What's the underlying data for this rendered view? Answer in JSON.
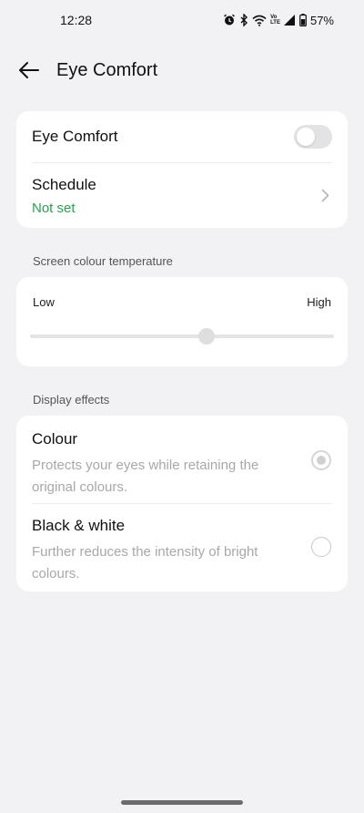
{
  "status_bar": {
    "time": "12:28",
    "battery": "57%",
    "icons": [
      "alarm-icon",
      "bluetooth-icon",
      "wifi-icon",
      "volte-icon",
      "signal-icon",
      "battery-icon"
    ],
    "volte_label_top": "Vo",
    "volte_label_bottom": "LTE"
  },
  "header": {
    "title": "Eye Comfort",
    "back_icon": "arrow-left-icon"
  },
  "eye_comfort": {
    "label": "Eye Comfort",
    "enabled": false
  },
  "schedule": {
    "label": "Schedule",
    "value": "Not set"
  },
  "temperature": {
    "section_label": "Screen colour temperature",
    "low_label": "Low",
    "high_label": "High",
    "level": 0.58
  },
  "display_effects": {
    "section_label": "Display effects",
    "options": [
      {
        "title": "Colour",
        "description": "Protects your eyes while retaining the original colours.",
        "selected": true
      },
      {
        "title": "Black & white",
        "description": "Further reduces the intensity of bright colours.",
        "selected": false
      }
    ]
  },
  "colors": {
    "accent_green": "#2e9e4f",
    "background": "#f2f2f4",
    "card": "#ffffff"
  }
}
